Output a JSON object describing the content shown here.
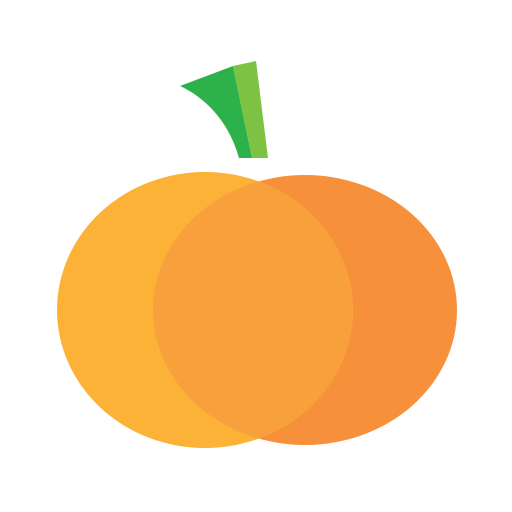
{
  "icon": {
    "name": "pumpkin-icon",
    "colors": {
      "background": "#ffffff",
      "left_lobe": "#FBB236",
      "right_lobe": "#F6903A",
      "overlap": "#F8A13C",
      "stem_dark": "#2DB14A",
      "stem_light": "#7DC242"
    }
  }
}
